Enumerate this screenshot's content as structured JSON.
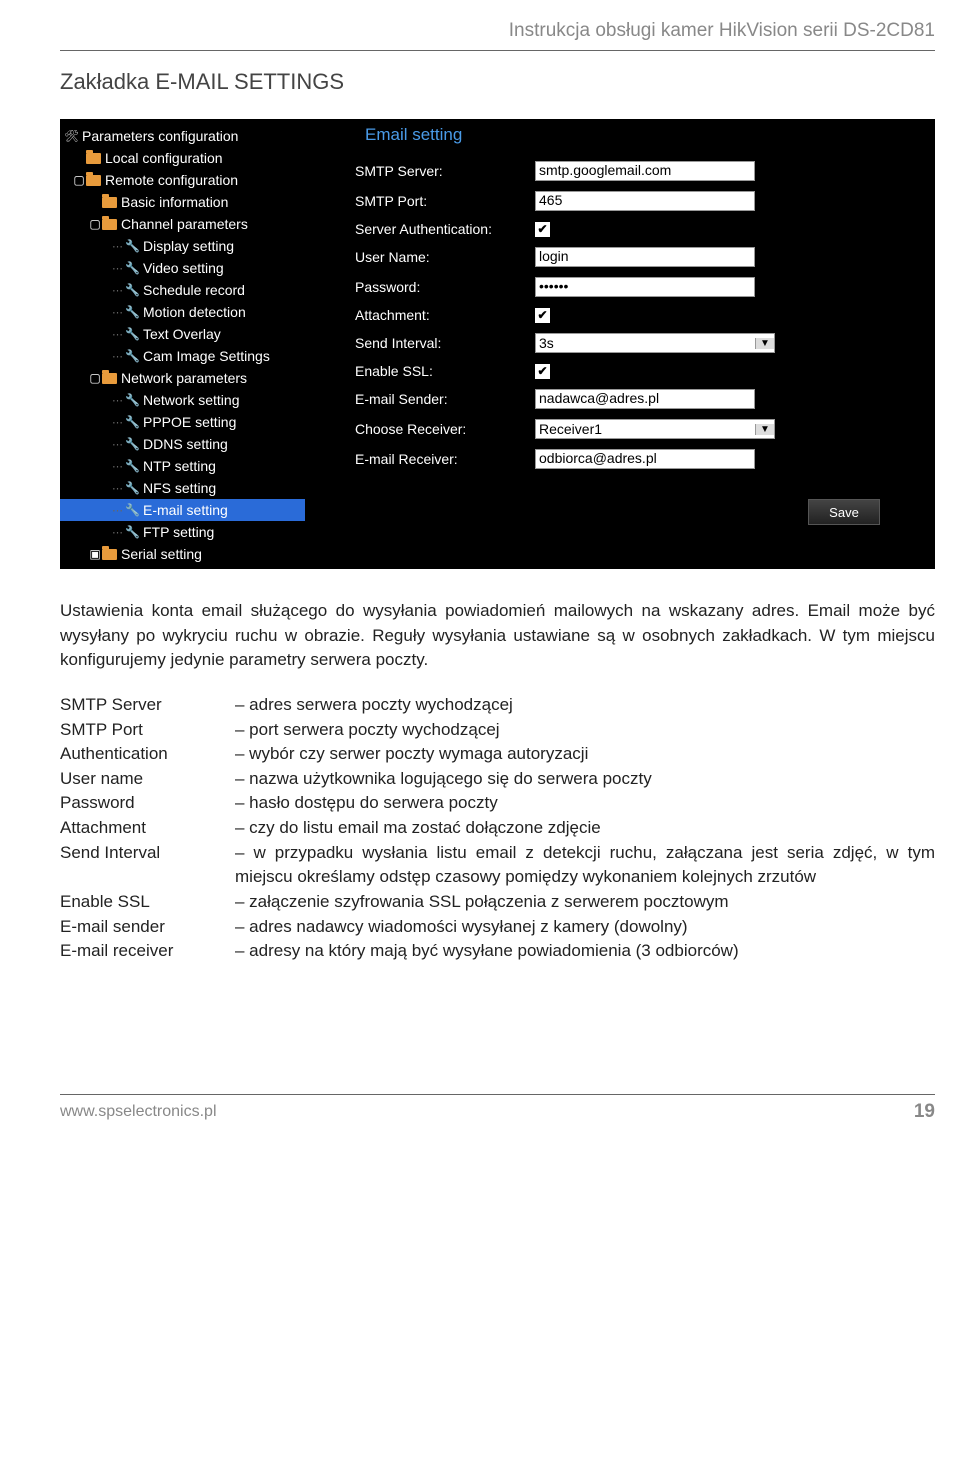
{
  "header": "Instrukcja obsługi kamer HikVision serii DS-2CD81",
  "section_title": "Zakładka E-MAIL SETTINGS",
  "app": {
    "title": "Email setting",
    "tree": {
      "root": "Parameters configuration",
      "local": "Local configuration",
      "remote": "Remote configuration",
      "basic": "Basic information",
      "channel": "Channel parameters",
      "display": "Display setting",
      "video": "Video setting",
      "schedule": "Schedule record",
      "motion": "Motion detection",
      "overlay": "Text Overlay",
      "cam": "Cam Image Settings",
      "network": "Network parameters",
      "net_set": "Network setting",
      "pppoe": "PPPOE setting",
      "ddns": "DDNS setting",
      "ntp": "NTP setting",
      "nfs": "NFS setting",
      "email": "E-mail setting",
      "ftp": "FTP setting",
      "serial": "Serial setting"
    },
    "form": {
      "smtp_server_label": "SMTP Server:",
      "smtp_server_value": "smtp.googlemail.com",
      "smtp_port_label": "SMTP Port:",
      "smtp_port_value": "465",
      "auth_label": "Server Authentication:",
      "user_label": "User Name:",
      "user_value": "login",
      "pass_label": "Password:",
      "pass_value": "••••••",
      "attach_label": "Attachment:",
      "interval_label": "Send Interval:",
      "interval_value": "3s",
      "ssl_label": "Enable SSL:",
      "sender_label": "E-mail Sender:",
      "sender_value": "nadawca@adres.pl",
      "receiver_sel_label": "Choose Receiver:",
      "receiver_sel_value": "Receiver1",
      "receiver_label": "E-mail Receiver:",
      "receiver_value": "odbiorca@adres.pl",
      "save": "Save"
    }
  },
  "body_text": "Ustawienia konta email służącego do wysyłania powiadomień mailowych na wskazany adres. Email może być wysyłany po wykryciu ruchu w obrazie. Reguły wysyłania ustawiane są w osobnych zakładkach. W tym miejscu konfigurujemy jedynie parametry serwera poczty.",
  "defs": [
    {
      "term": "SMTP Server",
      "desc": "– adres serwera poczty wychodzącej"
    },
    {
      "term": "SMTP Port",
      "desc": "– port serwera poczty wychodzącej"
    },
    {
      "term": "Authentication",
      "desc": "– wybór czy serwer poczty wymaga autoryzacji"
    },
    {
      "term": "User name",
      "desc": "– nazwa użytkownika logującego się do serwera poczty"
    },
    {
      "term": "Password",
      "desc": "– hasło dostępu do serwera poczty"
    },
    {
      "term": "Attachment",
      "desc": "– czy do listu email ma zostać dołączone zdjęcie"
    },
    {
      "term": "Send Interval",
      "desc": "– w przypadku wysłania listu email z detekcji ruchu, załączana jest seria zdjęć, w tym miejscu określamy odstęp czasowy pomiędzy wykonaniem kolejnych zrzutów"
    },
    {
      "term": "Enable SSL",
      "desc": "– załączenie szyfrowania SSL połączenia z serwerem pocztowym"
    },
    {
      "term": "E-mail sender",
      "desc": "– adres nadawcy wiadomości wysyłanej z kamery (dowolny)"
    },
    {
      "term": "E-mail receiver",
      "desc": "– adresy na który mają być wysyłane powiadomienia (3 odbiorców)"
    }
  ],
  "footer": {
    "url": "www.spselectronics.pl",
    "page": "19"
  }
}
